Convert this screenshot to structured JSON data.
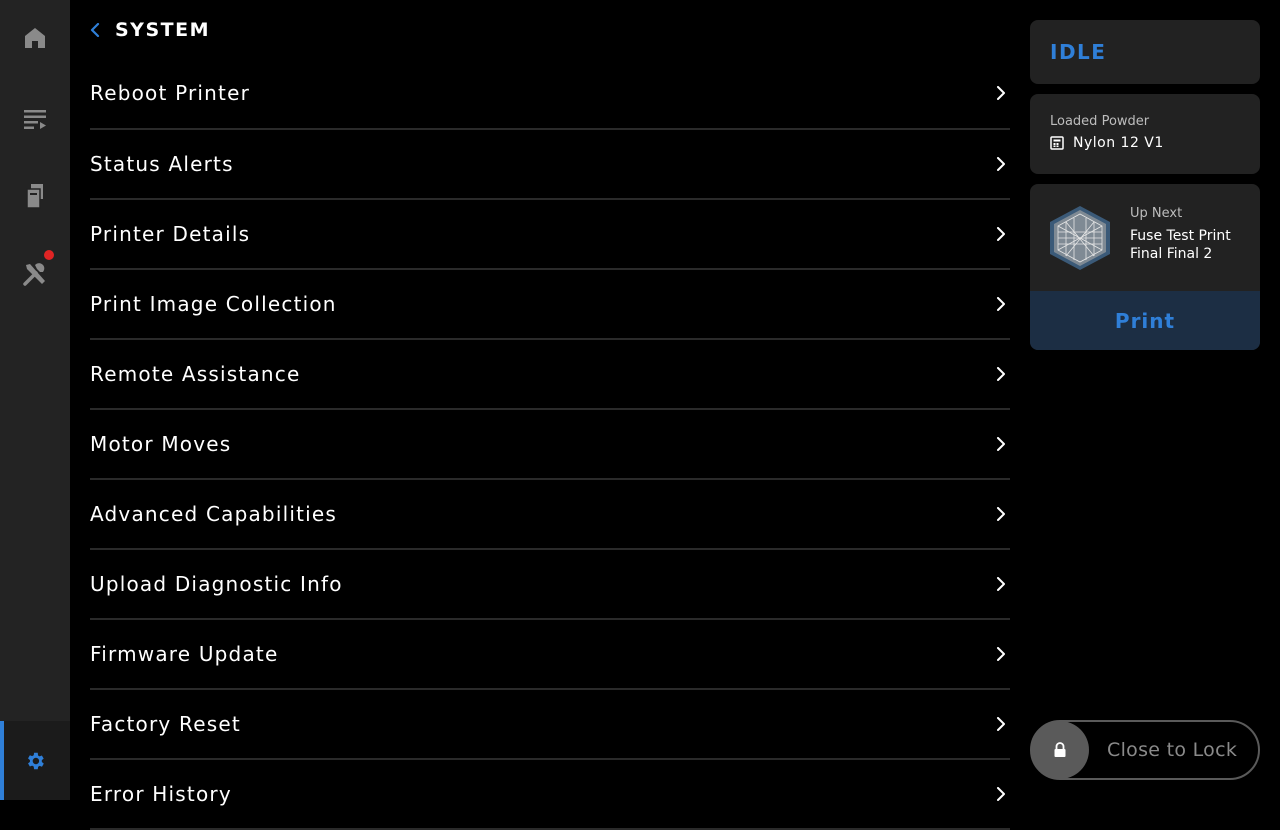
{
  "sidebar": {
    "items": [
      {
        "icon": "home-icon",
        "active": false
      },
      {
        "icon": "queue-icon",
        "active": false
      },
      {
        "icon": "materials-icon",
        "active": false
      },
      {
        "icon": "tools-icon",
        "active": false,
        "notification": true
      },
      {
        "icon": "settings-icon",
        "active": true
      }
    ]
  },
  "header": {
    "title": "SYSTEM"
  },
  "menu": {
    "items": [
      {
        "label": "Reboot Printer"
      },
      {
        "label": "Status Alerts"
      },
      {
        "label": "Printer Details"
      },
      {
        "label": "Print Image Collection"
      },
      {
        "label": "Remote Assistance"
      },
      {
        "label": "Motor Moves"
      },
      {
        "label": "Advanced Capabilities"
      },
      {
        "label": "Upload Diagnostic Info"
      },
      {
        "label": "Firmware Update"
      },
      {
        "label": "Factory Reset"
      },
      {
        "label": "Error History"
      }
    ]
  },
  "status": {
    "text": "IDLE"
  },
  "powder": {
    "label": "Loaded Powder",
    "value": "Nylon 12 V1"
  },
  "up_next": {
    "label": "Up Next",
    "name_line1": "Fuse Test Print",
    "name_line2": "Final Final 2",
    "print_label": "Print"
  },
  "lock": {
    "label": "Close to Lock"
  },
  "colors": {
    "accent": "#2f7fd8",
    "notification": "#e02424",
    "sidebar_bg": "#232323",
    "card_bg": "#222222"
  }
}
